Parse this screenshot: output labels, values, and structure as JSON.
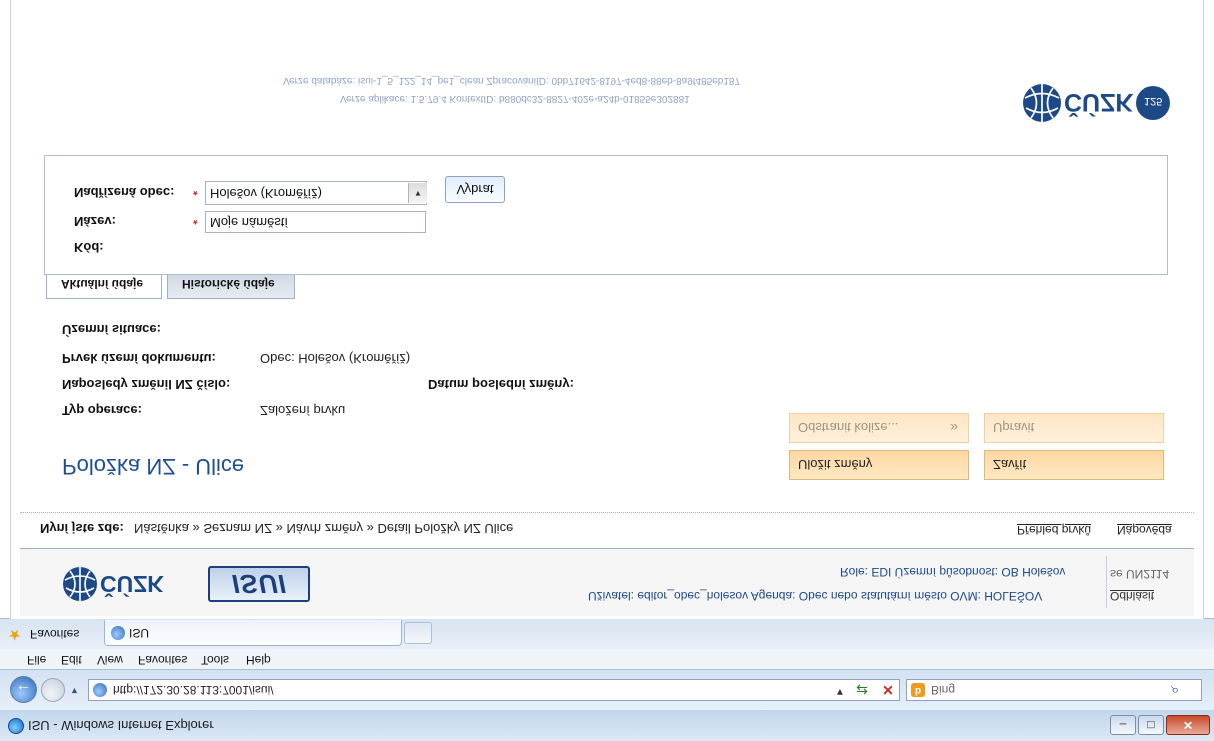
{
  "window": {
    "title": "ISU - Windows Internet Explorer",
    "minimize": "–",
    "maximize": "□",
    "close": "✕"
  },
  "browser": {
    "url": "http://172.30.28.113:7001/isui/",
    "search_placeholder": "Bing",
    "menu": [
      "File",
      "Edit",
      "View",
      "Favorites",
      "Tools",
      "Help"
    ],
    "favorites_label": "Favorites",
    "tab_title": "ISU"
  },
  "header": {
    "app_version": "Verze aplikace: 1.5.79.4 KontextID: b880dc32-8827-402e-a24b-01855e302881",
    "db_version": "Verze databáze: isui-1_5_122_14_pe1_clean ZpracovaniID: 0bb71642-8197-4ed8-88eb-8a9f485eb187",
    "logo_text": "ČÚZK",
    "logo_badge": "125"
  },
  "form": {
    "parent_label": "Nadřízená obec:",
    "parent_value": "Holešov (Kroměříž)",
    "choose_button": "Vybrat",
    "name_label": "Název:",
    "name_value": "Moje náměstí",
    "code_label": "Kód:",
    "required_mark": "*"
  },
  "tabs": {
    "current": "Aktuální údaje",
    "history": "Historické údaje"
  },
  "details": {
    "situation_label": "Územní situace:",
    "element_label": "Prvek území dokumentu:",
    "element_value": "Obec: Holešov (Kroměříž)",
    "last_changed_label": "Naposledy změnil NZ číslo:",
    "last_change_date_label": "Datum poslední změny:",
    "operation_label": "Typ operace:",
    "operation_value": "Založení prvku"
  },
  "actions": {
    "remove_collisions": "Odstranit kolize...",
    "edit": "Upravit",
    "save": "Uložit změny",
    "close": "Zavřít",
    "chevrons": "»"
  },
  "page_title": "Položka NZ - Ulice",
  "breadcrumb": {
    "label": "Nyní jste zde:",
    "path": "Nástěnka » Seznam NZ » Návrh změny » Detail Položky NZ Ulice",
    "overview": "Přehled prvků",
    "help": "Nápověda"
  },
  "footer": {
    "logo_text": "ČÚZK",
    "isu_logo": "ISUI",
    "role_line": "Role: EDI  Územní působnost: OB Holešov",
    "user_line": "Uživatel: editor_obec_holesov  Agenda: Obec nebo statutární město  OVM: HOLEŠOV",
    "version_code": "se UN2114",
    "logout": "Odhlásit"
  },
  "colors": {
    "accent": "#1f4f8f",
    "button_orange": "#fed7a2",
    "required": "#c0302a"
  }
}
